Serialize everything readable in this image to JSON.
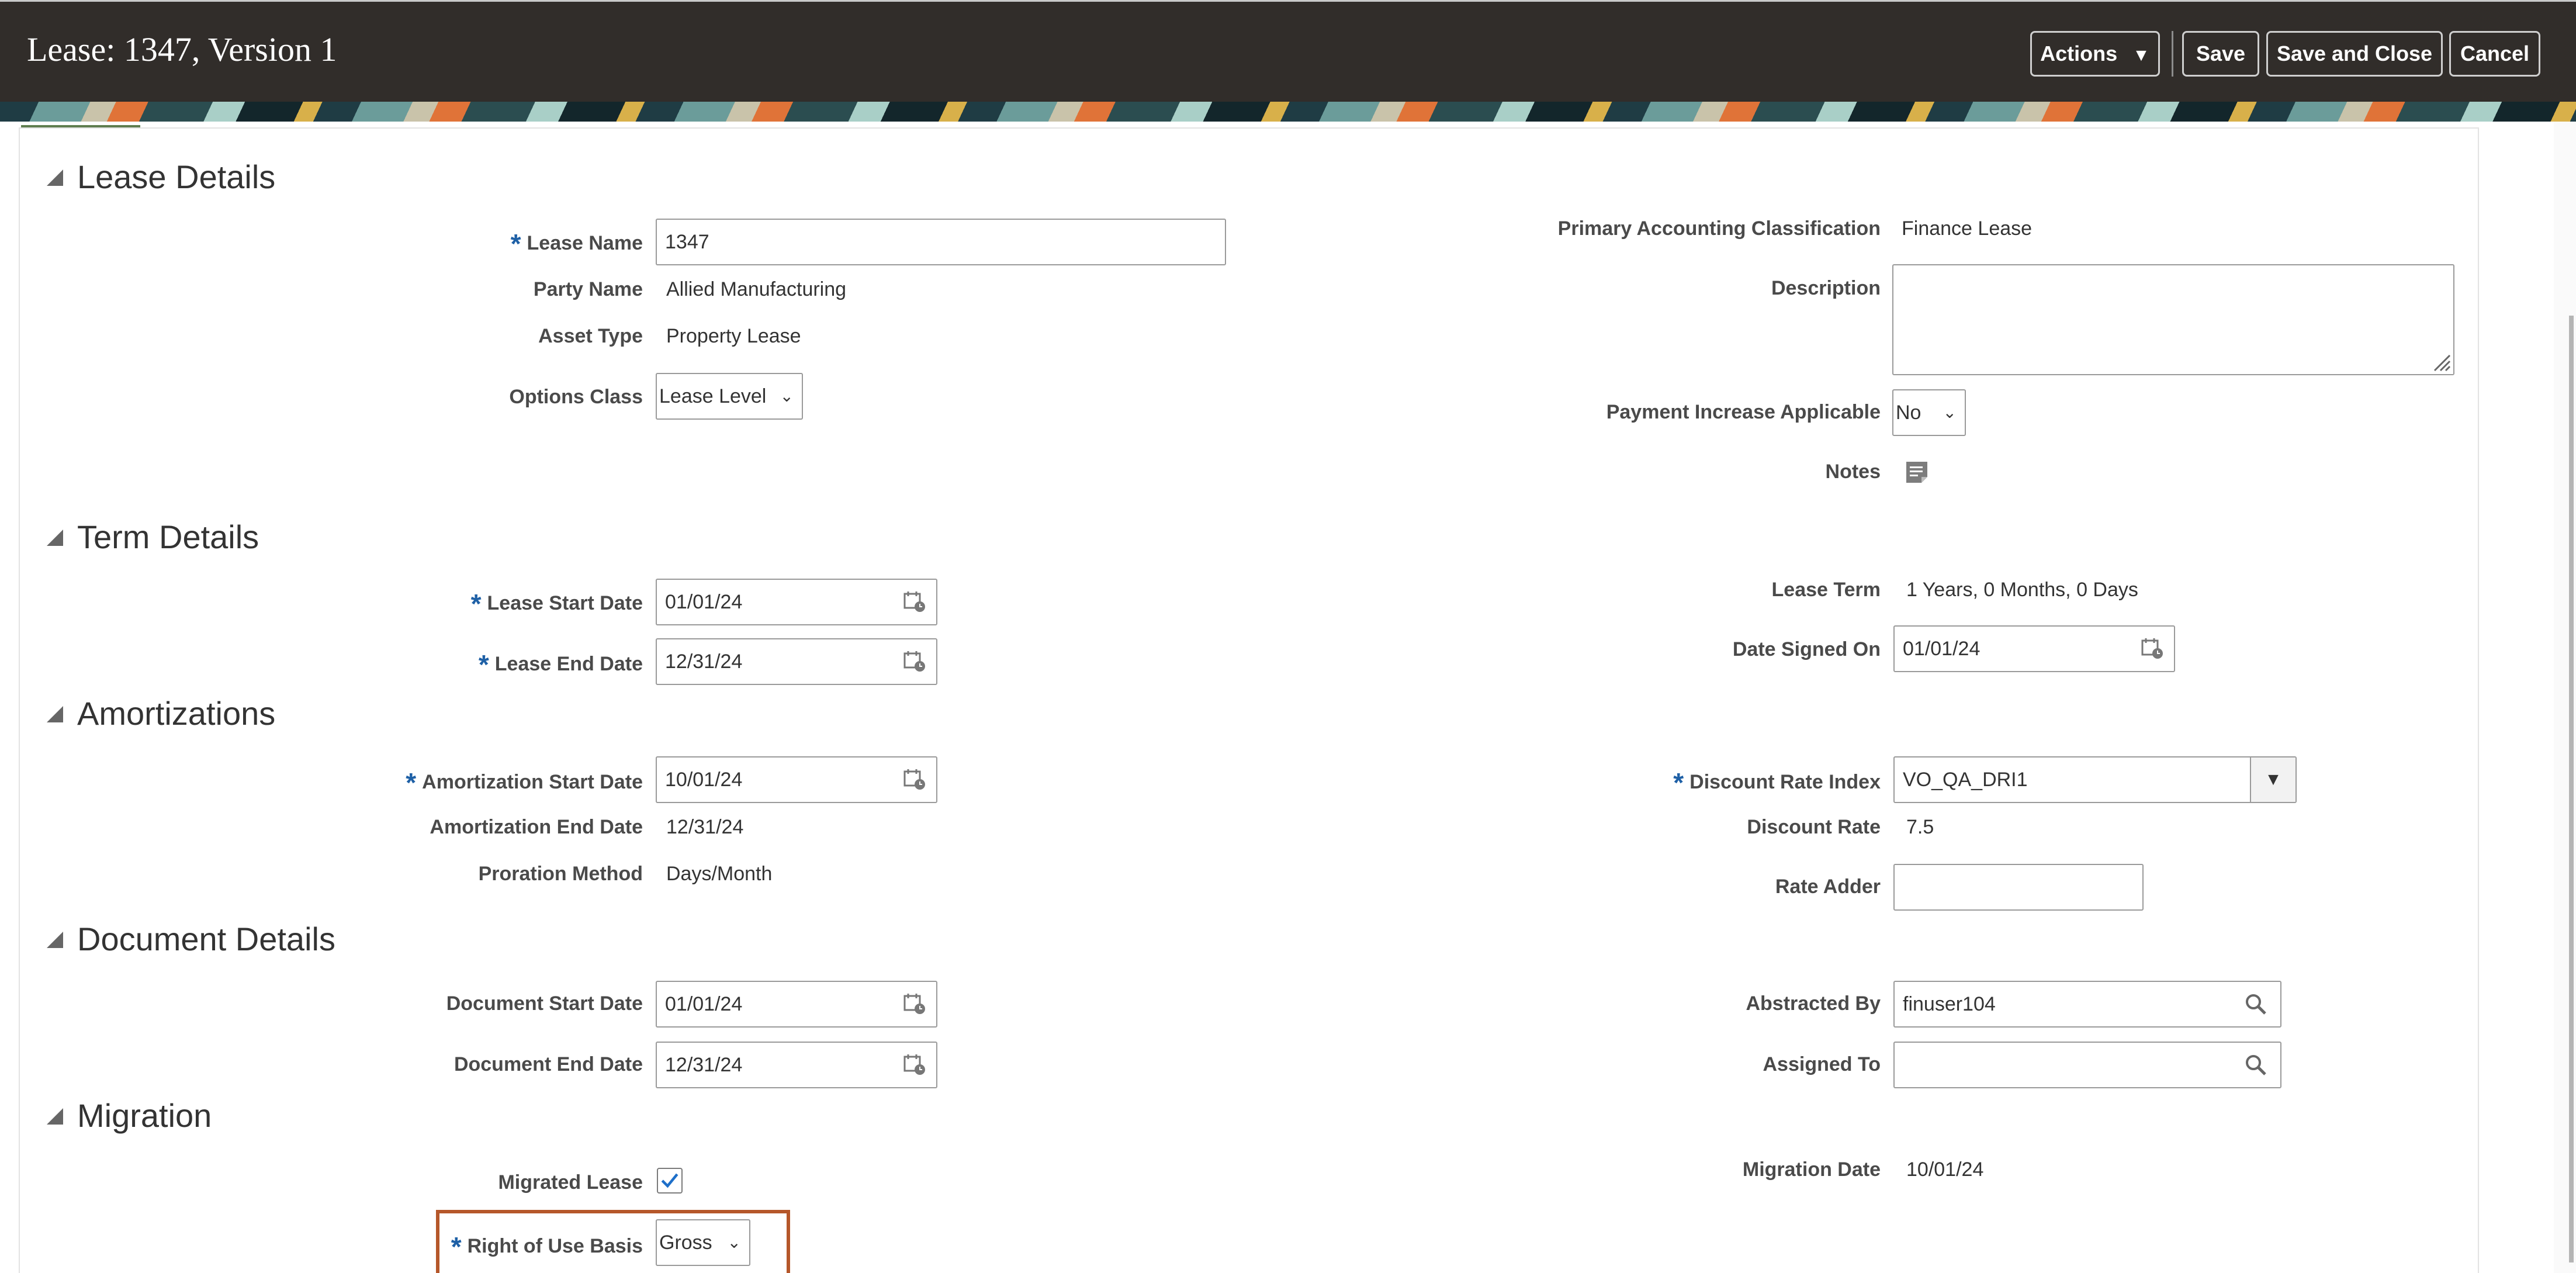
{
  "header": {
    "title": "Lease: 1347, Version 1",
    "actions_label": "Actions",
    "save_label": "Save",
    "save_close_label": "Save and Close",
    "cancel_label": "Cancel"
  },
  "sections": {
    "lease_details": "Lease Details",
    "term_details": "Term Details",
    "amortizations": "Amortizations",
    "document_details": "Document Details",
    "migration": "Migration"
  },
  "lease_details": {
    "lease_name_label": "Lease Name",
    "lease_name_value": "1347",
    "party_name_label": "Party Name",
    "party_name_value": "Allied Manufacturing",
    "asset_type_label": "Asset Type",
    "asset_type_value": "Property Lease",
    "options_class_label": "Options Class",
    "options_class_value": "Lease Level",
    "primary_accounting_label": "Primary Accounting Classification",
    "primary_accounting_value": "Finance Lease",
    "description_label": "Description",
    "description_value": "",
    "payment_increase_label": "Payment Increase Applicable",
    "payment_increase_value": "No",
    "notes_label": "Notes"
  },
  "term_details": {
    "lease_start_label": "Lease Start Date",
    "lease_start_value": "01/01/24",
    "lease_end_label": "Lease End Date",
    "lease_end_value": "12/31/24",
    "lease_term_label": "Lease Term",
    "lease_term_value": "1 Years, 0 Months, 0 Days",
    "date_signed_label": "Date Signed On",
    "date_signed_value": "01/01/24"
  },
  "amortizations": {
    "amort_start_label": "Amortization Start Date",
    "amort_start_value": "10/01/24",
    "amort_end_label": "Amortization End Date",
    "amort_end_value": "12/31/24",
    "proration_label": "Proration Method",
    "proration_value": "Days/Month",
    "discount_index_label": "Discount Rate Index",
    "discount_index_value": "VO_QA_DRI1",
    "discount_rate_label": "Discount Rate",
    "discount_rate_value": "7.5",
    "rate_adder_label": "Rate Adder",
    "rate_adder_value": ""
  },
  "document_details": {
    "doc_start_label": "Document Start Date",
    "doc_start_value": "01/01/24",
    "doc_end_label": "Document End Date",
    "doc_end_value": "12/31/24",
    "abstracted_by_label": "Abstracted By",
    "abstracted_by_value": "finuser104",
    "assigned_to_label": "Assigned To",
    "assigned_to_value": ""
  },
  "migration": {
    "migrated_lease_label": "Migrated Lease",
    "migrated_lease_checked": true,
    "migration_date_label": "Migration Date",
    "migration_date_value": "10/01/24",
    "rou_basis_label": "Right of Use Basis",
    "rou_basis_value": "Gross"
  },
  "colors": {
    "header_bg": "#312d2a",
    "required_star": "#1e60a6",
    "highlight_border": "#b5572a",
    "check_color": "#1e6fc9"
  },
  "icons": {
    "calendar": "calendar-icon",
    "search": "search-icon",
    "notes": "notes-icon",
    "dropdown": "chevron-down-icon",
    "collapse": "collapse-triangle-icon"
  }
}
